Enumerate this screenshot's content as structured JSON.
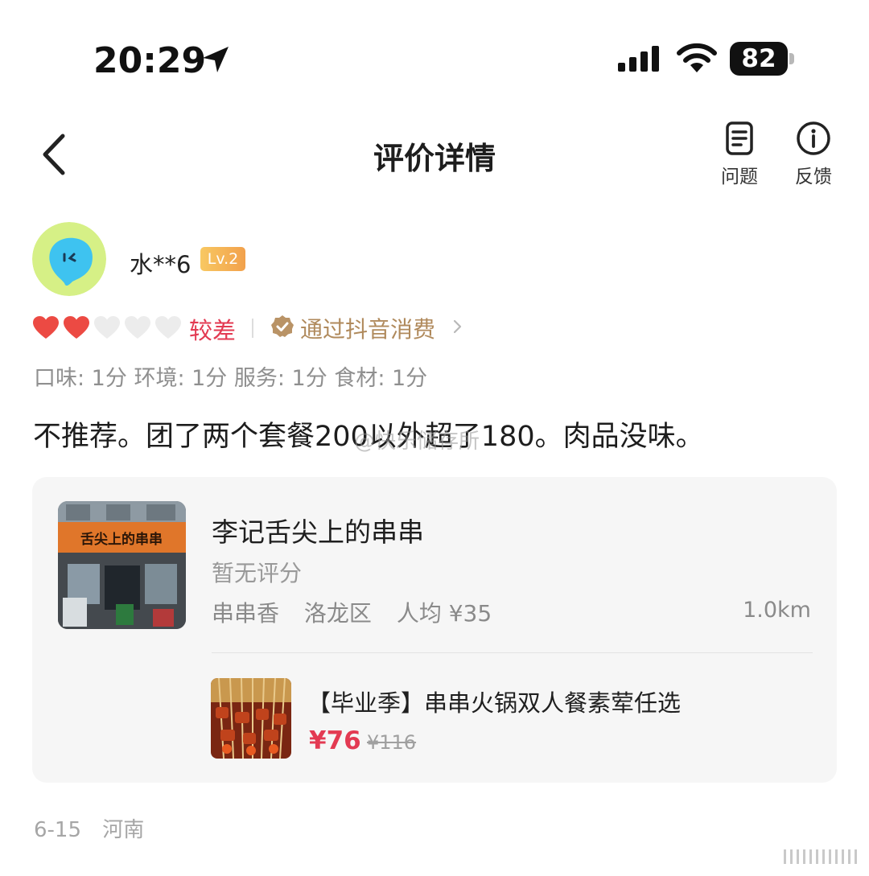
{
  "status_bar": {
    "time": "20:29",
    "battery": "82"
  },
  "header": {
    "title": "评价详情",
    "actions": [
      {
        "label": "问题",
        "icon": "document-icon"
      },
      {
        "label": "反馈",
        "icon": "info-icon"
      }
    ]
  },
  "user": {
    "name": "水**6",
    "level": "Lv.2"
  },
  "rating": {
    "hearts_filled": 2,
    "hearts_total": 5,
    "label": "较差",
    "verify_text": "通过抖音消费",
    "scores": "口味: 1分  环境: 1分  服务: 1分  食材: 1分"
  },
  "review": {
    "text": "不推荐。团了两个套餐200以外超了180。肉品没味。",
    "watermark": "@快乐储存所"
  },
  "store": {
    "name": "李记舌尖上的串串",
    "score_text": "暂无评分",
    "category": "串串香",
    "district": "洛龙区",
    "avg_price": "人均 ¥35",
    "distance": "1.0km",
    "sign_text": "舌尖上的串串"
  },
  "deal": {
    "title": "【毕业季】串串火锅双人餐素荤任选",
    "price": "¥76",
    "original_price": "¥116"
  },
  "footer": {
    "date": "6-15",
    "region": "河南"
  },
  "colors": {
    "accent_red": "#e33a52",
    "verify_gold": "#b08a5c",
    "muted_gray": "#8f8f8f"
  }
}
